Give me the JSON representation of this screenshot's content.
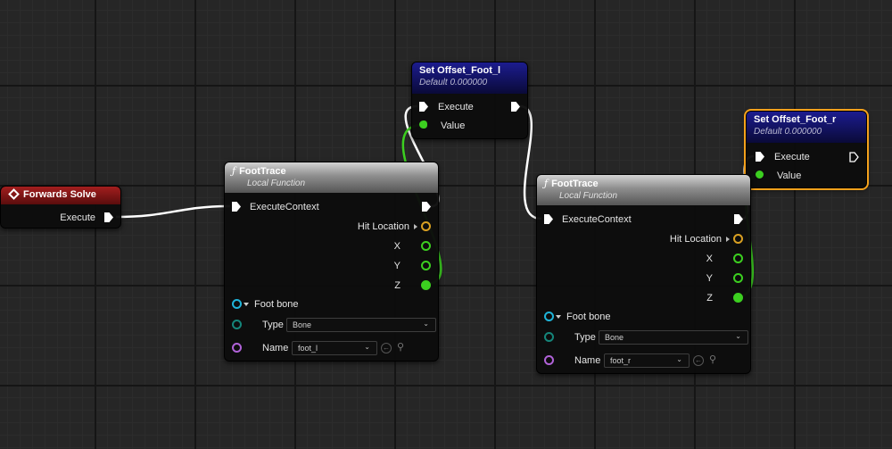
{
  "nodes": {
    "forwards_solve": {
      "title": "Forwards Solve",
      "execute": "Execute"
    },
    "set_offset_foot_l": {
      "title": "Set Offset_Foot_l",
      "default": "Default 0.000000",
      "execute": "Execute",
      "value": "Value"
    },
    "set_offset_foot_r": {
      "title": "Set Offset_Foot_r",
      "default": "Default 0.000000",
      "execute": "Execute",
      "value": "Value"
    },
    "foot_trace_l": {
      "title": "FootTrace",
      "subtitle": "Local Function",
      "execute_context": "ExecuteContext",
      "hit_location": "Hit Location",
      "x": "X",
      "y": "Y",
      "z": "Z",
      "foot_bone": "Foot bone",
      "type_label": "Type",
      "type_value": "Bone",
      "name_label": "Name",
      "name_value": "foot_l"
    },
    "foot_trace_r": {
      "title": "FootTrace",
      "subtitle": "Local Function",
      "execute_context": "ExecuteContext",
      "hit_location": "Hit Location",
      "x": "X",
      "y": "Y",
      "z": "Z",
      "foot_bone": "Foot bone",
      "type_label": "Type",
      "type_value": "Bone",
      "name_label": "Name",
      "name_value": "foot_r"
    }
  },
  "colors": {
    "exec_wire": "#ffffff",
    "float_wire": "#3ccf20",
    "event_header": "#a31e1e",
    "set_header": "#1c1c8f",
    "selection_outline": "#f4a11c"
  }
}
